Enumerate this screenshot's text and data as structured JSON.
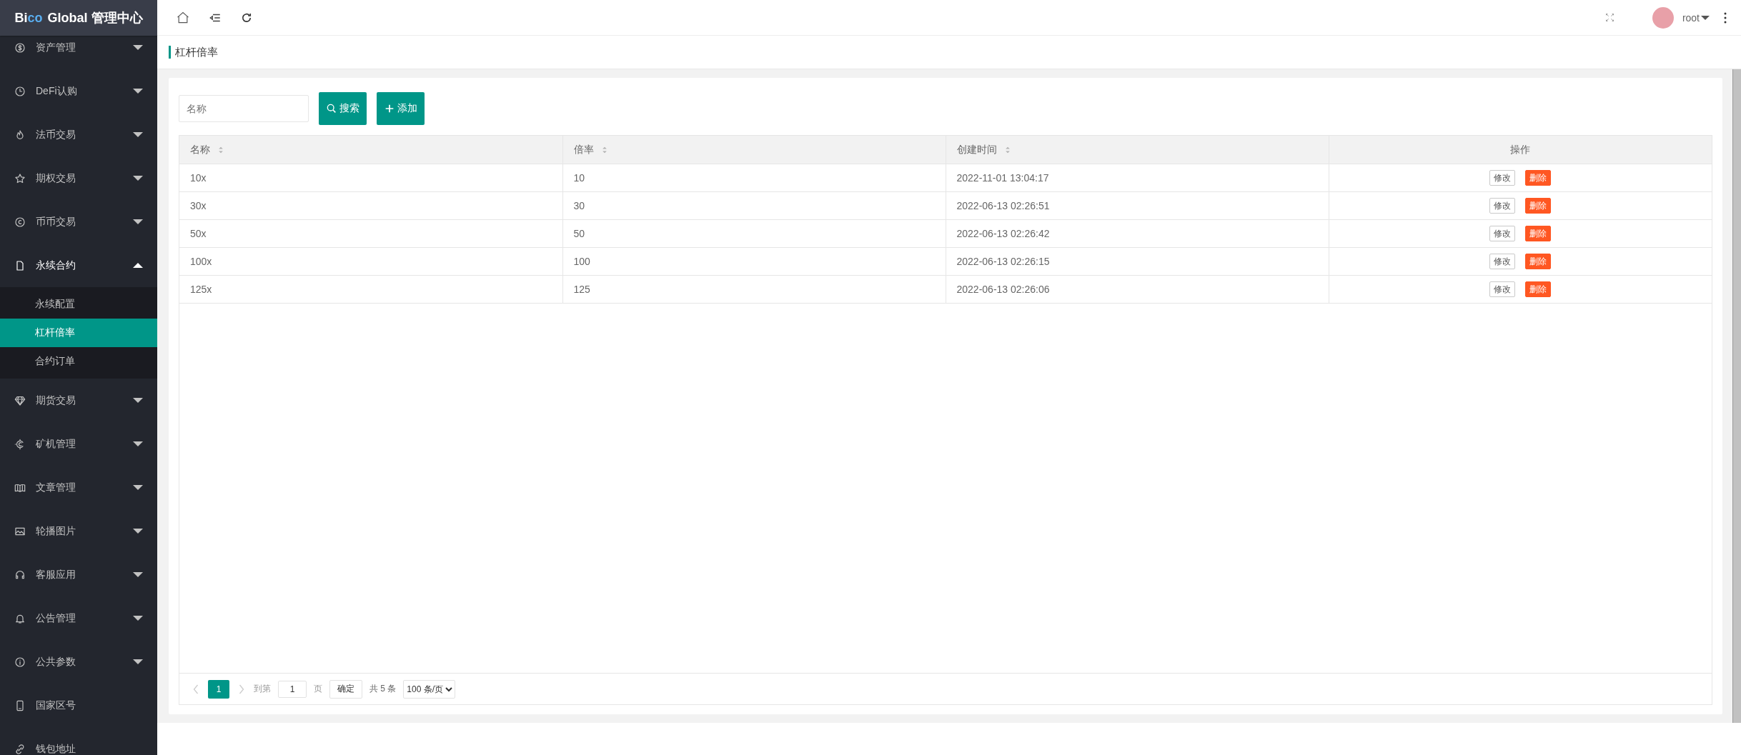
{
  "brand": {
    "parts": [
      {
        "text": "Bi",
        "color": "#ffffff"
      },
      {
        "text": "co",
        "color": "#5aaef0"
      }
    ],
    "rest": "Global 管理中心"
  },
  "sidebar": {
    "items": [
      {
        "label": "资产管理",
        "kind": "group",
        "expanded": false
      },
      {
        "label": "DeFi认购",
        "kind": "group",
        "expanded": false
      },
      {
        "label": "法币交易",
        "kind": "group",
        "expanded": false
      },
      {
        "label": "期权交易",
        "kind": "group",
        "expanded": false
      },
      {
        "label": "币币交易",
        "kind": "group",
        "expanded": false
      },
      {
        "label": "永续合约",
        "kind": "group",
        "expanded": true,
        "children": [
          {
            "label": "永续配置",
            "selected": false
          },
          {
            "label": "杠杆倍率",
            "selected": true
          },
          {
            "label": "合约订单",
            "selected": false
          }
        ]
      },
      {
        "label": "期货交易",
        "kind": "group",
        "expanded": false
      },
      {
        "label": "矿机管理",
        "kind": "group",
        "expanded": false
      },
      {
        "label": "文章管理",
        "kind": "group",
        "expanded": false
      },
      {
        "label": "轮播图片",
        "kind": "group",
        "expanded": false
      },
      {
        "label": "客服应用",
        "kind": "group",
        "expanded": false
      },
      {
        "label": "公告管理",
        "kind": "group",
        "expanded": false
      },
      {
        "label": "公共参数",
        "kind": "group",
        "expanded": false
      },
      {
        "label": "国家区号",
        "kind": "link"
      },
      {
        "label": "钱包地址",
        "kind": "link"
      }
    ]
  },
  "topbar": {
    "user": "root"
  },
  "page_title": "杠杆倍率",
  "search": {
    "placeholder": "名称",
    "buttons": [
      {
        "label": "搜索",
        "kind": "search"
      },
      {
        "label": "添加",
        "kind": "add"
      }
    ]
  },
  "table": {
    "columns": [
      {
        "label": "名称",
        "sortable": true
      },
      {
        "label": "倍率",
        "sortable": true
      },
      {
        "label": "创建时间",
        "sortable": true
      },
      {
        "label": "操作",
        "sortable": false
      }
    ],
    "rows": [
      {
        "cells": [
          "10x",
          "10",
          "2022-11-01 13:04:17"
        ],
        "actions": [
          {
            "label": "修改",
            "kind": "edit"
          },
          {
            "label": "删除",
            "kind": "danger"
          }
        ]
      },
      {
        "cells": [
          "30x",
          "30",
          "2022-06-13 02:26:51"
        ],
        "actions": [
          {
            "label": "修改",
            "kind": "edit"
          },
          {
            "label": "删除",
            "kind": "danger"
          }
        ]
      },
      {
        "cells": [
          "50x",
          "50",
          "2022-06-13 02:26:42"
        ],
        "actions": [
          {
            "label": "修改",
            "kind": "edit"
          },
          {
            "label": "删除",
            "kind": "danger"
          }
        ]
      },
      {
        "cells": [
          "100x",
          "100",
          "2022-06-13 02:26:15"
        ],
        "actions": [
          {
            "label": "修改",
            "kind": "edit"
          },
          {
            "label": "删除",
            "kind": "danger"
          }
        ]
      },
      {
        "cells": [
          "125x",
          "125",
          "2022-06-13 02:26:06"
        ],
        "actions": [
          {
            "label": "修改",
            "kind": "edit"
          },
          {
            "label": "删除",
            "kind": "danger"
          }
        ]
      }
    ]
  },
  "pagination": {
    "pages": [
      {
        "label": "1",
        "selected": true
      }
    ],
    "goto_label": "到第",
    "goto_value": "1",
    "page_unit": "页",
    "confirm": "确定",
    "total": "共 5 条",
    "page_size": "100 条/页"
  }
}
